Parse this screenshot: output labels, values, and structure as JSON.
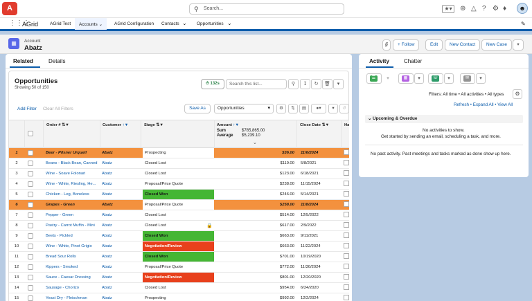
{
  "topbar": {
    "logo_text": "A",
    "search_placeholder": "Search...",
    "avatar_icon": "avatar-icon"
  },
  "nav": {
    "app_name": "AGrid",
    "tabs": [
      "AGrid Test",
      "Accounts",
      "AGrid Configuration",
      "Contacts",
      "Opportunities"
    ]
  },
  "record": {
    "type": "Account",
    "name": "Abatz",
    "buttons": {
      "follow": "+ Follow",
      "edit": "Edit",
      "new_contact": "New Contact",
      "new_case": "New Case"
    }
  },
  "left_tabs": {
    "related": "Related",
    "details": "Details"
  },
  "opportunities": {
    "title": "Opportunities",
    "subtitle": "Showing 50 of 150",
    "timer": "132s",
    "search_placeholder": "Search this list...",
    "add_filter": "Add Filter",
    "clear_filters": "Clear All Filters",
    "save_as": "Save As",
    "view": "Opportunities",
    "columns": {
      "order": "Order #",
      "customer": "Customer",
      "stage": "Stage",
      "amount": "Amount",
      "close_date": "Close Date",
      "extra": "Ha"
    },
    "summary": {
      "sum_label": "Sum",
      "sum_value": "$785,865.00",
      "avg_label": "Average",
      "avg_value": "$5,239.10"
    },
    "rows": [
      {
        "n": "1",
        "product": "Beer - Pilsner Urquell",
        "customer": "Abatz",
        "stage": "Prospecting",
        "amount": "$36.00",
        "close": "11/6/2024",
        "style": "hl"
      },
      {
        "n": "2",
        "product": "Beans - Black Bean, Canned",
        "customer": "Abatz",
        "stage": "Closed Lost",
        "amount": "$119.00",
        "close": "5/8/2021",
        "style": ""
      },
      {
        "n": "3",
        "product": "Wine - Soave Folonari",
        "customer": "Abatz",
        "stage": "Closed Lost",
        "amount": "$123.00",
        "close": "6/18/2021",
        "style": ""
      },
      {
        "n": "4",
        "product": "Wine - White, Riesling, He...",
        "customer": "Abatz",
        "stage": "Proposal/Price Quote",
        "amount": "$238.00",
        "close": "11/15/2024",
        "style": ""
      },
      {
        "n": "5",
        "product": "Chicken - Leg, Boneless",
        "customer": "Abatz",
        "stage": "Closed Won",
        "amount": "$246.00",
        "close": "5/14/2021",
        "style": "won"
      },
      {
        "n": "6",
        "product": "Grapes - Green",
        "customer": "Abatz",
        "stage": "Proposal/Price Quote",
        "amount": "$258.00",
        "close": "11/8/2024",
        "style": "hl"
      },
      {
        "n": "7",
        "product": "Pepper - Green",
        "customer": "Abatz",
        "stage": "Closed Lost",
        "amount": "$514.00",
        "close": "12/5/2022",
        "style": ""
      },
      {
        "n": "8",
        "product": "Pastry - Carrot Muffin - Mini",
        "customer": "Abatz",
        "stage": "Closed Lost",
        "amount": "$617.00",
        "close": "2/9/2022",
        "style": "lock"
      },
      {
        "n": "9",
        "product": "Beets - Pickled",
        "customer": "Abatz",
        "stage": "Closed Won",
        "amount": "$663.00",
        "close": "9/11/2021",
        "style": "won"
      },
      {
        "n": "10",
        "product": "Wine - White, Pinot Grigio",
        "customer": "Abatz",
        "stage": "Negotiation/Review",
        "amount": "$663.00",
        "close": "11/22/2024",
        "style": "neg"
      },
      {
        "n": "11",
        "product": "Bread Sour Rolls",
        "customer": "Abatz",
        "stage": "Closed Won",
        "amount": "$701.00",
        "close": "10/19/2020",
        "style": "won"
      },
      {
        "n": "12",
        "product": "Kippers - Smoked",
        "customer": "Abatz",
        "stage": "Proposal/Price Quote",
        "amount": "$772.00",
        "close": "11/30/2024",
        "style": ""
      },
      {
        "n": "13",
        "product": "Sauce - Caesar Dressing",
        "customer": "Abatz",
        "stage": "Negotiation/Review",
        "amount": "$801.00",
        "close": "12/20/2020",
        "style": "neg"
      },
      {
        "n": "14",
        "product": "Sausage - Chorizo",
        "customer": "Abatz",
        "stage": "Closed Lost",
        "amount": "$954.00",
        "close": "6/24/2020",
        "style": ""
      },
      {
        "n": "15",
        "product": "Yeast Dry - Fleischman",
        "customer": "Abatz",
        "stage": "Prospecting",
        "amount": "$992.00",
        "close": "12/2/2024",
        "style": ""
      }
    ]
  },
  "activity": {
    "tabs": {
      "activity": "Activity",
      "chatter": "Chatter"
    },
    "filters": "Filters: All time • All activities • All types",
    "links": "Refresh  •  Expand All  •  View All",
    "upcoming": "Upcoming & Overdue",
    "no_activities": "No activities to show.",
    "get_started": "Get started by sending an email, scheduling a task, and more.",
    "past": "No past activity. Past meetings and tasks marked as done show up here."
  },
  "colors": {
    "brand": "#0b5cab",
    "highlight_row": "#f3913e",
    "won": "#45b634",
    "negotiation": "#e8401c"
  }
}
